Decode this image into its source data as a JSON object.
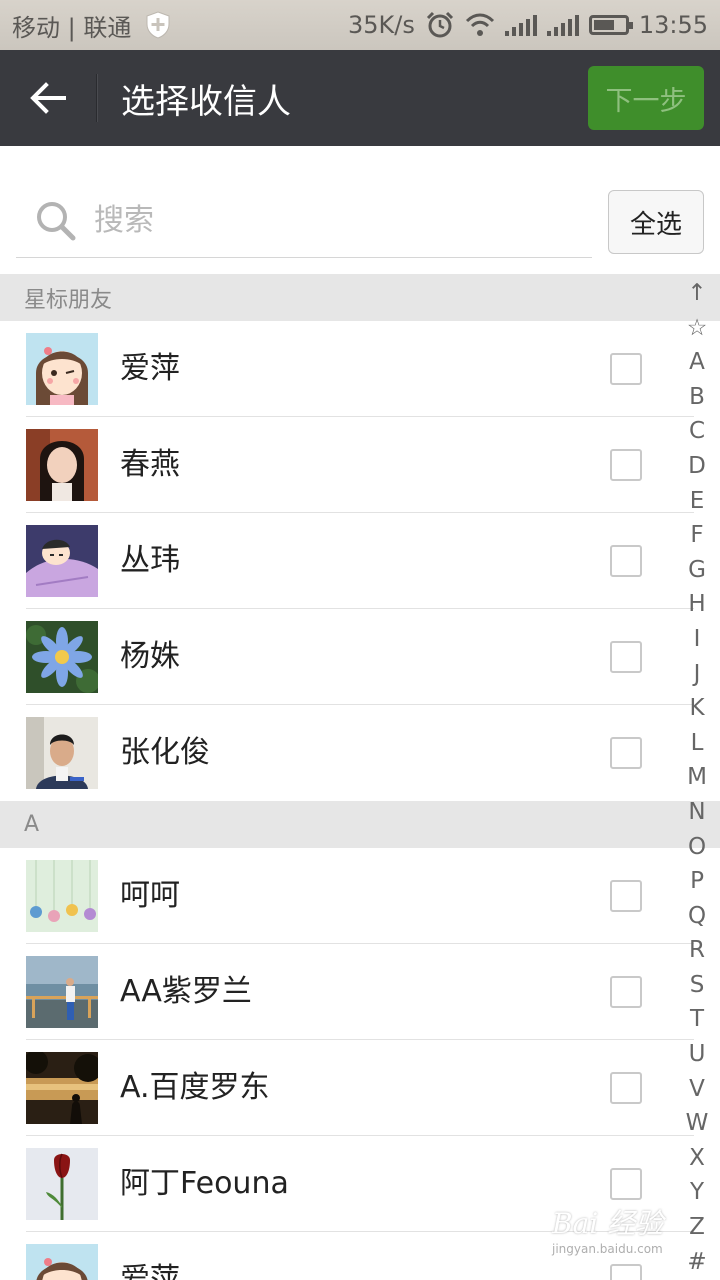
{
  "status_bar": {
    "carrier": "移动 | 联通",
    "speed": "35K/s",
    "time": "13:55"
  },
  "header": {
    "title": "选择收信人",
    "next_label": "下一步"
  },
  "search": {
    "placeholder": "搜索",
    "select_all_label": "全选"
  },
  "sections": [
    {
      "title": "星标朋友",
      "contacts": [
        {
          "name": "爱萍",
          "avatar": "cartoon-girl",
          "checked": false
        },
        {
          "name": "春燕",
          "avatar": "woman-photo",
          "checked": false
        },
        {
          "name": "丛玮",
          "avatar": "cartoon-sleeping",
          "checked": false
        },
        {
          "name": "杨姝",
          "avatar": "flower-photo",
          "checked": false
        },
        {
          "name": "张化俊",
          "avatar": "man-photo",
          "checked": false
        }
      ]
    },
    {
      "title": "A",
      "contacts": [
        {
          "name": "呵呵",
          "avatar": "dream-photo",
          "checked": false
        },
        {
          "name": "AA紫罗兰",
          "avatar": "lakeside-photo",
          "checked": false
        },
        {
          "name": "A.百度罗东",
          "avatar": "sunset-photo",
          "checked": false
        },
        {
          "name": "阿丁Feouna",
          "avatar": "tulip-photo",
          "checked": false
        },
        {
          "name": "爱萍",
          "avatar": "cartoon-girl",
          "checked": false
        }
      ]
    }
  ],
  "index_letters": [
    "↑",
    "☆",
    "A",
    "B",
    "C",
    "D",
    "E",
    "F",
    "G",
    "H",
    "I",
    "J",
    "K",
    "L",
    "M",
    "N",
    "O",
    "P",
    "Q",
    "R",
    "S",
    "T",
    "U",
    "V",
    "W",
    "X",
    "Y",
    "Z",
    "#"
  ],
  "watermark": {
    "text": "Bai 经验",
    "url": "jingyan.baidu.com"
  },
  "colors": {
    "header_bg": "#393a3f",
    "next_button_bg": "#3f8e2b",
    "section_bg": "#e6e6e6"
  }
}
